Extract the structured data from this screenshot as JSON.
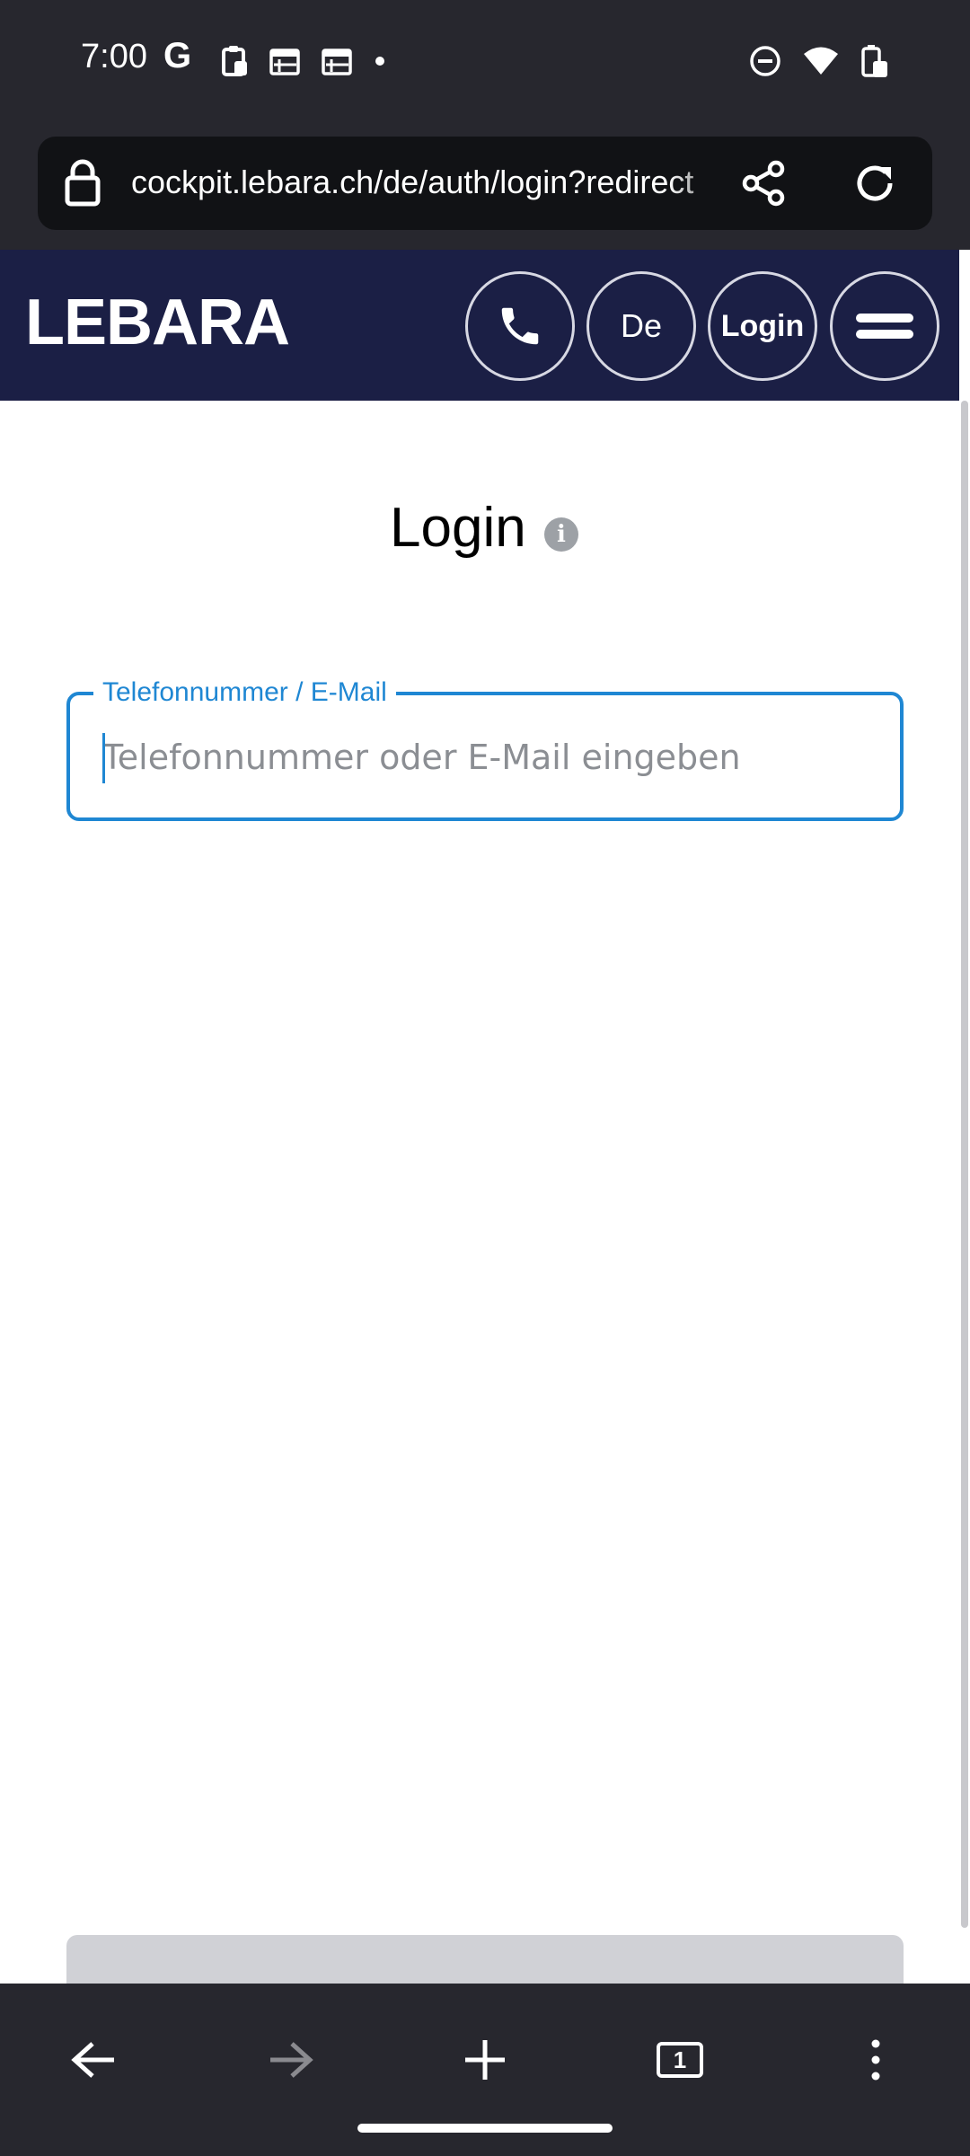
{
  "status_bar": {
    "time": "7:00",
    "left_icons": [
      "google-icon",
      "clipboard-icon",
      "calendar-icon",
      "calendar-icon",
      "dot-icon"
    ],
    "right_icons": [
      "dnd-icon",
      "wifi-icon",
      "battery-icon"
    ]
  },
  "browser": {
    "url": "cockpit.lebara.ch/de/auth/login?redirect",
    "tab_count": "1"
  },
  "header": {
    "logo": "LEBARA",
    "language_label": "De",
    "login_label": "Login"
  },
  "login": {
    "title": "Login",
    "info_glyph": "i",
    "field_label": "Telefonnummer / E-Mail",
    "field_placeholder": "Telefonnummer oder E-Mail eingeben",
    "field_value": ""
  },
  "colors": {
    "header_bg": "#1b1f45",
    "chrome_bg": "#27272e",
    "accent": "#1f87d3"
  }
}
